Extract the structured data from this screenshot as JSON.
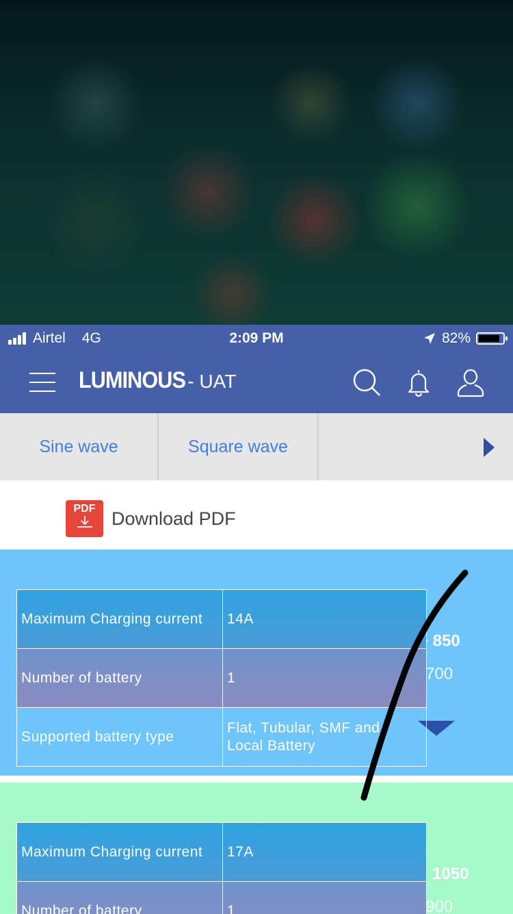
{
  "status_bar": {
    "carrier": "Airtel",
    "network": "4G",
    "time": "2:09 PM",
    "battery": "82%"
  },
  "header": {
    "logo": "LUMINOUS",
    "env": "- UAT"
  },
  "tabs": [
    "Sine wave",
    "Square wave"
  ],
  "download": {
    "label": "Download PDF",
    "icon_text": "PDF"
  },
  "cards": [
    {
      "bg": "#6ec5fb",
      "hidden_price": "+ 850",
      "hidden_sub": "700",
      "specs": [
        {
          "key": "Maximum Charging current",
          "value": "14A"
        },
        {
          "key": "Number of battery",
          "value": "1"
        },
        {
          "key": "Supported battery type",
          "value": "Flat, Tubular, SMF and",
          "value2": " Local Battery"
        }
      ]
    },
    {
      "bg": "#a6f9c8",
      "hidden_price": "1050",
      "hidden_sub": "900",
      "specs": [
        {
          "key": "Maximum Charging current",
          "value": "17A"
        },
        {
          "key": "Number of battery",
          "value": "1"
        }
      ]
    }
  ],
  "colors": {
    "header": "#4560a8",
    "tab_text": "#3f7ee8",
    "pdf_red": "#e8453a"
  },
  "icons": [
    "signal-icon",
    "location-arrow-icon",
    "battery-icon",
    "menu-icon",
    "search-icon",
    "bell-icon",
    "user-icon",
    "chevron-right-icon",
    "pdf-icon",
    "chevron-down-icon"
  ]
}
